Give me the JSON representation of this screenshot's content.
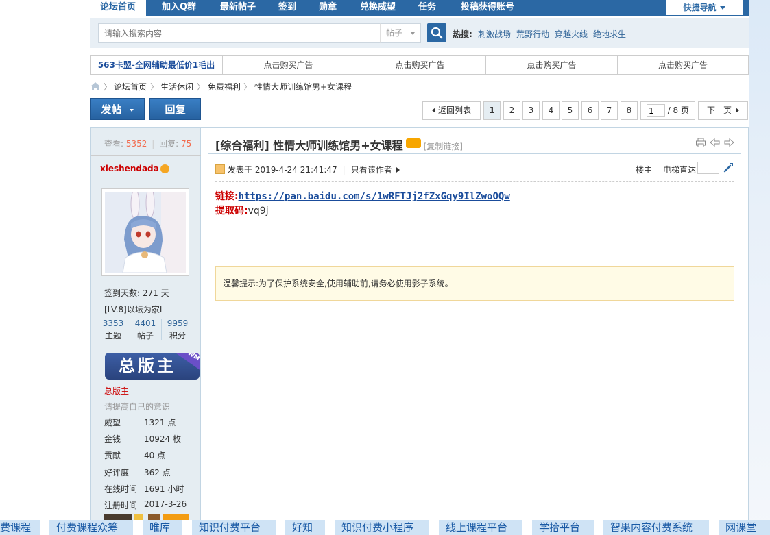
{
  "nav": {
    "items": [
      "论坛首页",
      "加入Q群",
      "最新帖子",
      "签到",
      "勋章",
      "兑换威望",
      "任务",
      "投稿获得账号"
    ],
    "quick_nav": "快捷导航"
  },
  "search": {
    "placeholder": "请输入搜索内容",
    "type": "帖子",
    "hot_label": "热搜:",
    "hot_links": [
      "刺激战场",
      "荒野行动",
      "穿越火线",
      "绝地求生"
    ]
  },
  "ads": [
    "563卡盟-全网辅助最低价1毛出",
    "点击购买广告",
    "点击购买广告",
    "点击购买广告",
    "点击购买广告"
  ],
  "breadcrumb": [
    "论坛首页",
    "生活休闲",
    "免费福利",
    "性情大师训练馆男+女课程"
  ],
  "buttons": {
    "post": "发帖",
    "reply": "回复"
  },
  "pager": {
    "back": "返回列表",
    "pages": [
      "1",
      "2",
      "3",
      "4",
      "5",
      "6",
      "7",
      "8"
    ],
    "current_input": "1",
    "total": "/ 8 页",
    "next": "下一页"
  },
  "sidebar": {
    "views_label": "查看:",
    "views": "5352",
    "replies_label": "回复:",
    "replies": "75",
    "author": "xieshendada",
    "signin_days": "签到天数: 271 天",
    "level": "[LV.8]以坛为家I",
    "stats": [
      {
        "num": "3353",
        "label": "主题"
      },
      {
        "num": "4401",
        "label": "帖子"
      },
      {
        "num": "9959",
        "label": "积分"
      }
    ],
    "badge_text": "总版主",
    "badge_corner": "WM",
    "role": "总版主",
    "motto": "请提高自己的意识",
    "profile": [
      {
        "k": "威望",
        "v": "1321 点"
      },
      {
        "k": "金钱",
        "v": "10924 枚"
      },
      {
        "k": "贡献",
        "v": "40 点"
      },
      {
        "k": "好评度",
        "v": "362 点"
      },
      {
        "k": "在线时间",
        "v": "1691 小时"
      },
      {
        "k": "注册时间",
        "v": "2017-3-26"
      }
    ]
  },
  "post": {
    "title": "[综合福利] 性情大师训练馆男+女课程",
    "copy_link": "[复制链接]",
    "posted": "发表于 2019-4-24 21:41:47",
    "only_author": "只看该作者",
    "floor": "楼主",
    "elevator": "电梯直达",
    "link_label": "链接:",
    "link_url": "https://pan.baidu.com/s/1wRFTJj2fZxGqy9IlZwoOQw",
    "code_label": "提取码:",
    "code": "vq9j",
    "tip": "温馨提示:为了保护系统安全,使用辅助前,请务必使用影子系统。"
  },
  "bottom_strip": [
    "费课程",
    "付费课程众筹",
    "唯库",
    "知识付费平台",
    "好知",
    "知识付费小程序",
    "线上课程平台",
    "学拾平台",
    "智果内容付费系统",
    "网课堂"
  ],
  "colors": {
    "nav_blue": "#2b68a4",
    "sidebar_bg": "#e5edf2",
    "accent_red": "#cc0000"
  }
}
